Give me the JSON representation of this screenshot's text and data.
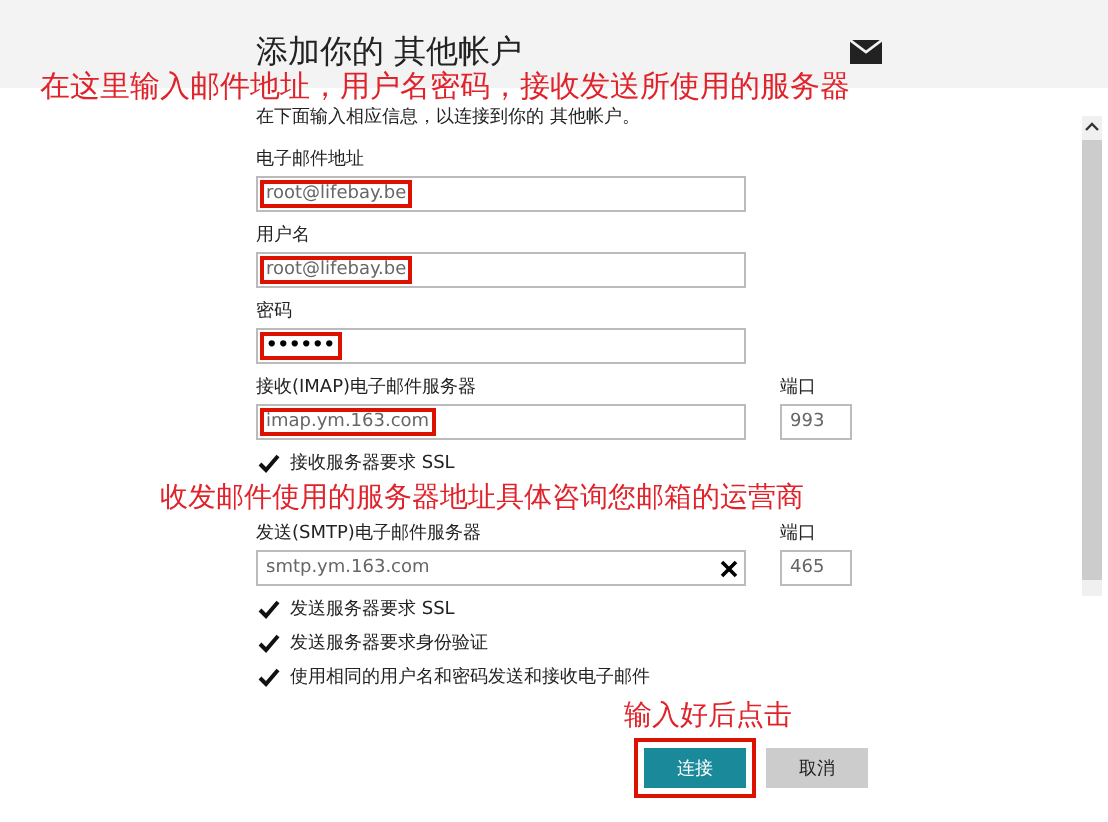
{
  "header": {
    "title": "添加你的 其他帐户"
  },
  "subtitle": "在下面输入相应信息，以连接到你的 其他帐户。",
  "fields": [
    {
      "label": "电子邮件地址",
      "value": "root@lifebay.be",
      "kind": "text",
      "highlighted": true
    },
    {
      "label": "用户名",
      "value": "root@lifebay.be",
      "kind": "text",
      "highlighted": true
    },
    {
      "label": "密码",
      "value": "••••••",
      "kind": "password",
      "highlighted": true
    },
    {
      "label": "接收(IMAP)电子邮件服务器",
      "value": "imap.ym.163.com",
      "kind": "server",
      "highlighted": true,
      "port_label": "端口",
      "port": "993",
      "clear": false,
      "checkboxes": [
        {
          "label": "接收服务器要求 SSL",
          "checked": true
        }
      ]
    },
    {
      "label": "发送(SMTP)电子邮件服务器",
      "value": "smtp.ym.163.com",
      "kind": "server",
      "highlighted": false,
      "port_label": "端口",
      "port": "465",
      "clear": true
    }
  ],
  "checkboxes": [
    {
      "label": "发送服务器要求 SSL",
      "checked": true
    },
    {
      "label": "发送服务器要求身份验证",
      "checked": true
    },
    {
      "label": "使用相同的用户名和密码发送和接收电子邮件",
      "checked": true
    }
  ],
  "buttons": [
    {
      "label": "连接",
      "kind": "primary",
      "highlighted": true
    },
    {
      "label": "取消",
      "kind": "secondary",
      "highlighted": false
    }
  ],
  "annotations": [
    "在这里输入邮件地址，用户名密码，接收发送所使用的服务器",
    "收发邮件使用的服务器地址具体咨询您邮箱的运营商",
    "输入好后点击"
  ]
}
